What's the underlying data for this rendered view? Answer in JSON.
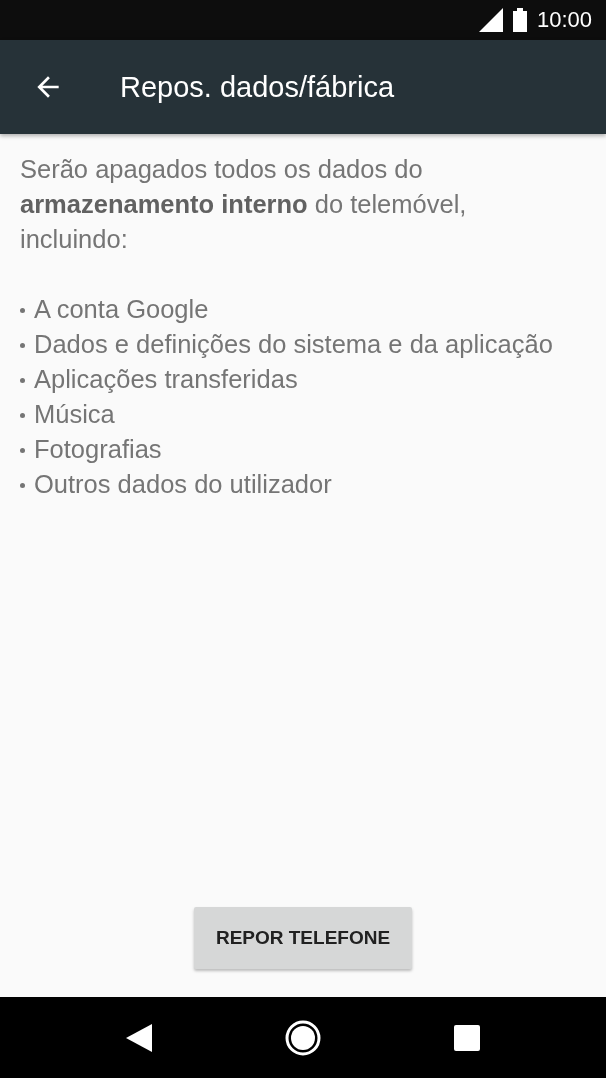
{
  "status_bar": {
    "time": "10:00"
  },
  "toolbar": {
    "title": "Repos. dados/fábrica"
  },
  "message": "Serão apagados todos os dados do **armazenamento interno** do telemóvel, incluindo:",
  "items": [
    "A conta Google",
    "Dados e definições do sistema e da aplicação",
    "Aplicações transferidas",
    "Música",
    "Fotografias",
    "Outros dados do utilizador"
  ],
  "button": {
    "label": "REPOR TELEFONE"
  }
}
